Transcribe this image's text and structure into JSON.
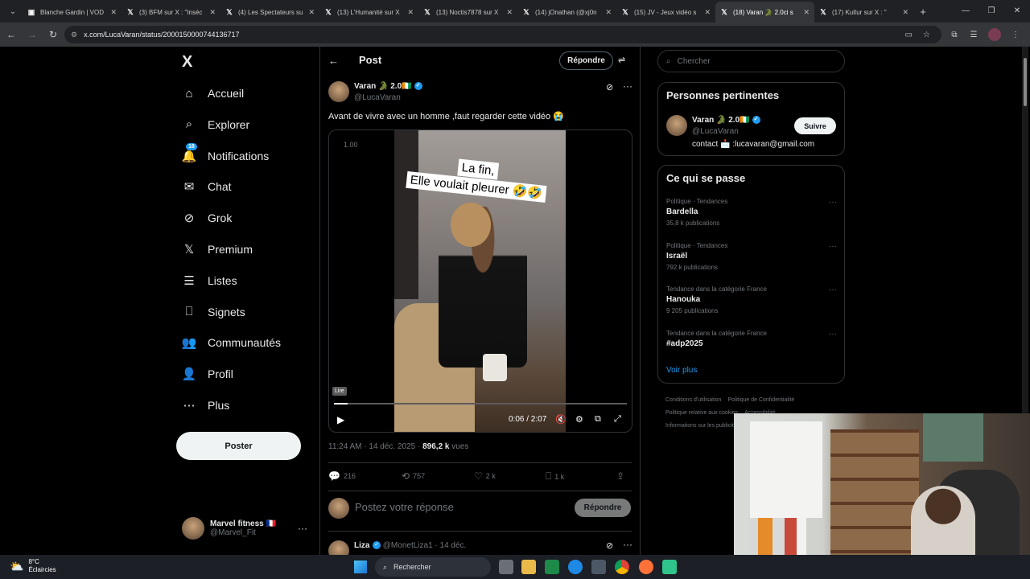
{
  "browser": {
    "tabs": [
      {
        "icon": "twitch-icon",
        "title": "Blanche Gardin | VOD"
      },
      {
        "icon": "x-icon",
        "title": "(3) BFM sur X : \"Inséc"
      },
      {
        "icon": "x-icon",
        "title": "(4) Les Spectateurs su"
      },
      {
        "icon": "x-icon",
        "title": "(13) L'Humanité sur X"
      },
      {
        "icon": "x-icon",
        "title": "(13) Noctis7878 sur X"
      },
      {
        "icon": "x-icon",
        "title": "(14) jOnathan (@xj0n"
      },
      {
        "icon": "x-icon",
        "title": "(15) JV - Jeux vidéo s"
      },
      {
        "icon": "x-icon",
        "title": "(18) Varan 🐊 2.0ci s",
        "active": true
      },
      {
        "icon": "x-icon",
        "title": "(17) Kultur sur X : \""
      }
    ],
    "url": "x.com/LucaVaran/status/2000150000744136717"
  },
  "sidebar": {
    "logo": "X",
    "items": [
      {
        "label": "Accueil",
        "icon": "home-icon"
      },
      {
        "label": "Explorer",
        "icon": "search-icon"
      },
      {
        "label": "Notifications",
        "icon": "bell-icon",
        "badge": "18"
      },
      {
        "label": "Chat",
        "icon": "mail-icon"
      },
      {
        "label": "Grok",
        "icon": "grok-icon"
      },
      {
        "label": "Premium",
        "icon": "x-premium-icon"
      },
      {
        "label": "Listes",
        "icon": "list-icon"
      },
      {
        "label": "Signets",
        "icon": "bookmark-icon"
      },
      {
        "label": "Communautés",
        "icon": "communities-icon"
      },
      {
        "label": "Profil",
        "icon": "user-icon"
      },
      {
        "label": "Plus",
        "icon": "more-circle-icon"
      }
    ],
    "post_button": "Poster",
    "account": {
      "name": "Marvel fitness 🇫🇷",
      "handle": "@Marvel_Fit"
    }
  },
  "header": {
    "title": "Post",
    "reply_button": "Répondre"
  },
  "tweet": {
    "author": "Varan 🐊 2.0🇨🇮",
    "handle": "@LucaVaran",
    "text": "Avant de vivre avec un homme ,faut regarder cette vidéo 😭",
    "video": {
      "speed": "1.00",
      "caption_line1": "La fin,",
      "caption_line2": "Elle voulait pleurer 🤣🤣",
      "tooltip": "Lire",
      "time": "0:06 / 2:07",
      "progress": 0.047
    },
    "timestamp": "11:24 AM · 14 déc. 2025 · ",
    "views_count": "896,2 k",
    "views_label": "vues",
    "stats": {
      "replies": "216",
      "reposts": "757",
      "likes": "2 k",
      "bookmarks": "1 k"
    }
  },
  "reply_box": {
    "placeholder": "Postez votre réponse",
    "button": "Répondre"
  },
  "next_tweet": {
    "author": "Liza",
    "meta": "@MonetLiza1 · 14 déc."
  },
  "right": {
    "search_placeholder": "Chercher",
    "relevant": {
      "title": "Personnes pertinentes",
      "name": "Varan 🐊 2.0🇨🇮",
      "handle": "@LucaVaran",
      "bio": "contact 📩 :lucavaran@gmail.com",
      "follow": "Suivre"
    },
    "trends": {
      "title": "Ce qui se passe",
      "items": [
        {
          "context": "Politique · Tendances",
          "name": "Bardella",
          "posts": "35,8 k publications"
        },
        {
          "context": "Politique · Tendances",
          "name": "Israël",
          "posts": "792 k publications"
        },
        {
          "context": "Tendance dans la catégorie France",
          "name": "Hanouka",
          "posts": "9 205 publications"
        },
        {
          "context": "Tendance dans la catégorie France",
          "name": "#adp2025",
          "posts": ""
        }
      ],
      "see_more": "Voir plus"
    },
    "footer": [
      "Conditions d'utilisation",
      "Politique de Confidentialité",
      "Politique relative aux cookies",
      "Accessibilité",
      "Informations sur les publicités"
    ]
  },
  "taskbar": {
    "temp": "8°C",
    "weather": "Éclaircies",
    "search": "Rechercher"
  }
}
